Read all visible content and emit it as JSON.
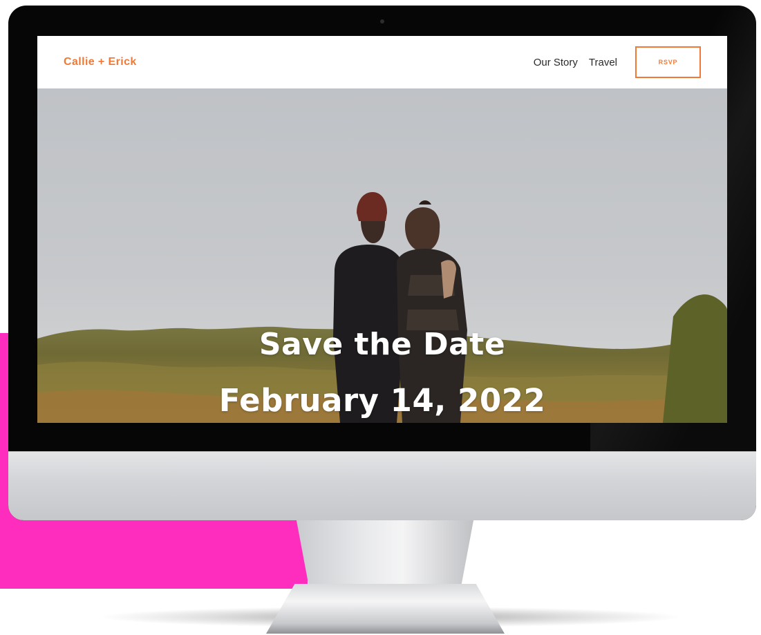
{
  "site": {
    "brand": "Callie + Erick",
    "nav": [
      {
        "label": "Our Story"
      },
      {
        "label": "Travel"
      }
    ],
    "rsvp_label": "RSVP"
  },
  "hero": {
    "title": "Save the Date",
    "date": "February 14, 2022"
  },
  "colors": {
    "brand_orange": "#f07a35",
    "accent_pink": "#ff2dbd",
    "hero_text": "#ffffff"
  }
}
